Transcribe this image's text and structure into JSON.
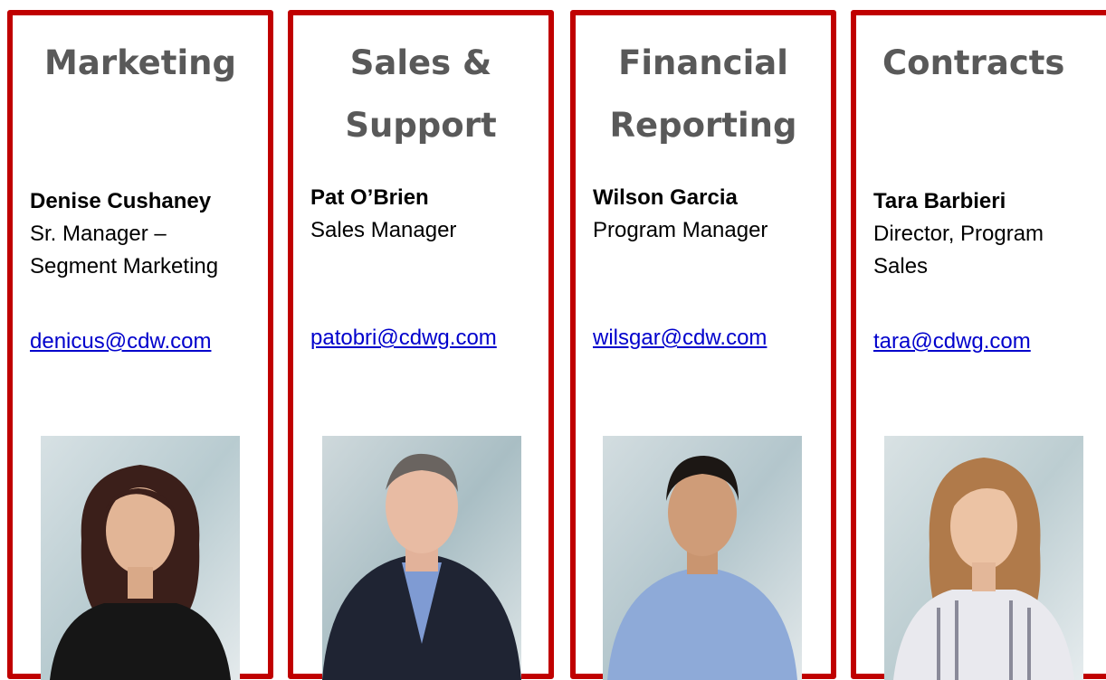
{
  "cards": [
    {
      "department": "Marketing",
      "name": "Denise Cushaney",
      "role": "Sr. Manager –\nSegment Marketing",
      "email": "denicus@cdw.com",
      "photo_icon": "woman-portrait-icon"
    },
    {
      "department": "Sales &\nSupport",
      "name": "Pat O’Brien",
      "role": "Sales Manager",
      "email": "patobri@cdwg.com",
      "photo_icon": "man-portrait-icon"
    },
    {
      "department": "Financial\nReporting",
      "name": "Wilson Garcia",
      "role": "Program Manager",
      "email": "wilsgar@cdw.com",
      "photo_icon": "man-portrait-icon"
    },
    {
      "department": "Contracts",
      "name": "Tara Barbieri",
      "role": "Director, Program\nSales",
      "email": "tara@cdwg.com",
      "photo_icon": "woman-portrait-icon"
    }
  ],
  "colors": {
    "border": "#c00000",
    "heading": "#595959",
    "link": "#0000cc"
  }
}
